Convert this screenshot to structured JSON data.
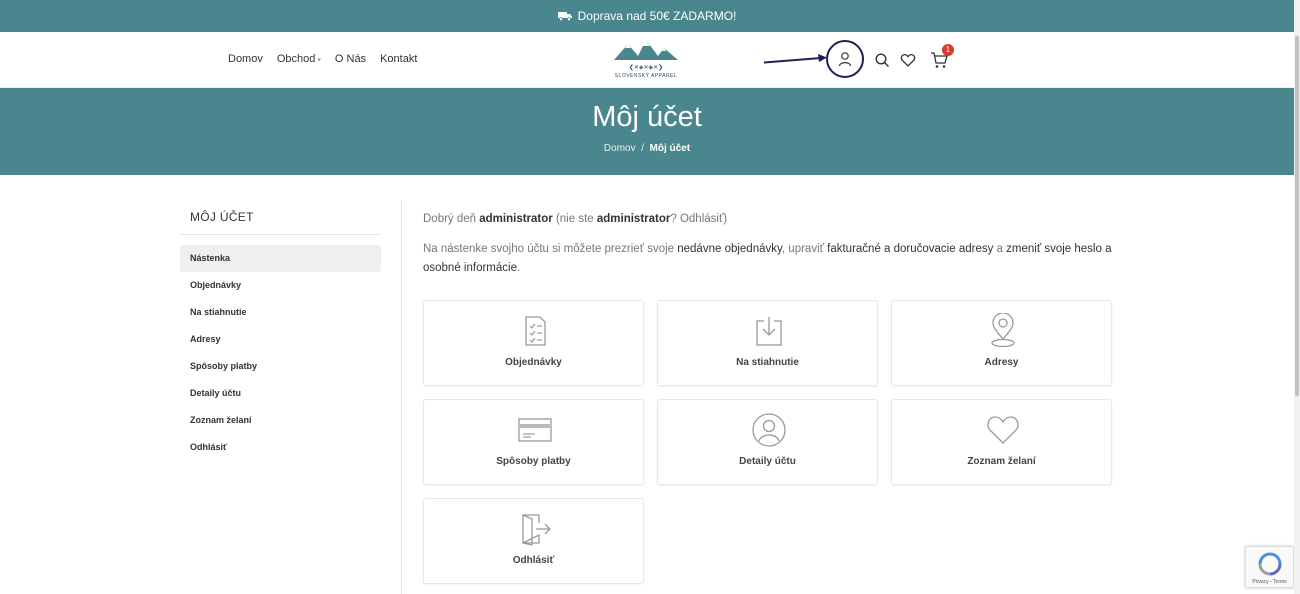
{
  "topbar": {
    "text": "Doprava nad 50€ ZADARMO!",
    "icon": "truck-icon"
  },
  "nav": {
    "items": [
      "Domov",
      "Obchod",
      "O Nás",
      "Kontakt"
    ]
  },
  "logo": {
    "text": "SLOVENSKÝ APPAREL"
  },
  "header_icons": {
    "cart_count": "1"
  },
  "hero": {
    "title": "Môj účet",
    "crumb_home": "Domov",
    "crumb_sep": "/",
    "crumb_current": "Môj účet"
  },
  "sidebar": {
    "title": "MÔJ ÚČET",
    "items": [
      "Nástenka",
      "Objednávky",
      "Na stiahnutie",
      "Adresy",
      "Spôsoby platby",
      "Detaily účtu",
      "Zoznam želaní",
      "Odhlásiť"
    ]
  },
  "content": {
    "greet_1": "Dobrý deň ",
    "greet_user": "administrator",
    "greet_2": " (nie ste ",
    "greet_user2": "administrator",
    "greet_3": "? ",
    "greet_logout": "Odhlásiť",
    "greet_4": ")",
    "intro_1": "Na nástenke svojho účtu si môžete prezrieť svoje ",
    "intro_link1": "nedávne objednávky",
    "intro_2": ", upraviť ",
    "intro_link2": "fakturačné a doručovacie adresy",
    "intro_3": " a ",
    "intro_link3": "zmeniť svoje heslo a osobné informácie",
    "intro_4": "."
  },
  "cards": [
    {
      "label": "Objednávky",
      "icon": "orders-icon"
    },
    {
      "label": "Na stiahnutie",
      "icon": "download-icon"
    },
    {
      "label": "Adresy",
      "icon": "location-pin-icon"
    },
    {
      "label": "Spôsoby platby",
      "icon": "credit-card-icon"
    },
    {
      "label": "Detaily účtu",
      "icon": "user-icon"
    },
    {
      "label": "Zoznam želaní",
      "icon": "heart-icon"
    },
    {
      "label": "Odhlásiť",
      "icon": "logout-icon"
    }
  ],
  "recaptcha": {
    "text": "Privacy - Terms"
  },
  "colors": {
    "brand": "#4a868d",
    "highlight_circle": "#1f2156",
    "badge": "#d93b30"
  }
}
